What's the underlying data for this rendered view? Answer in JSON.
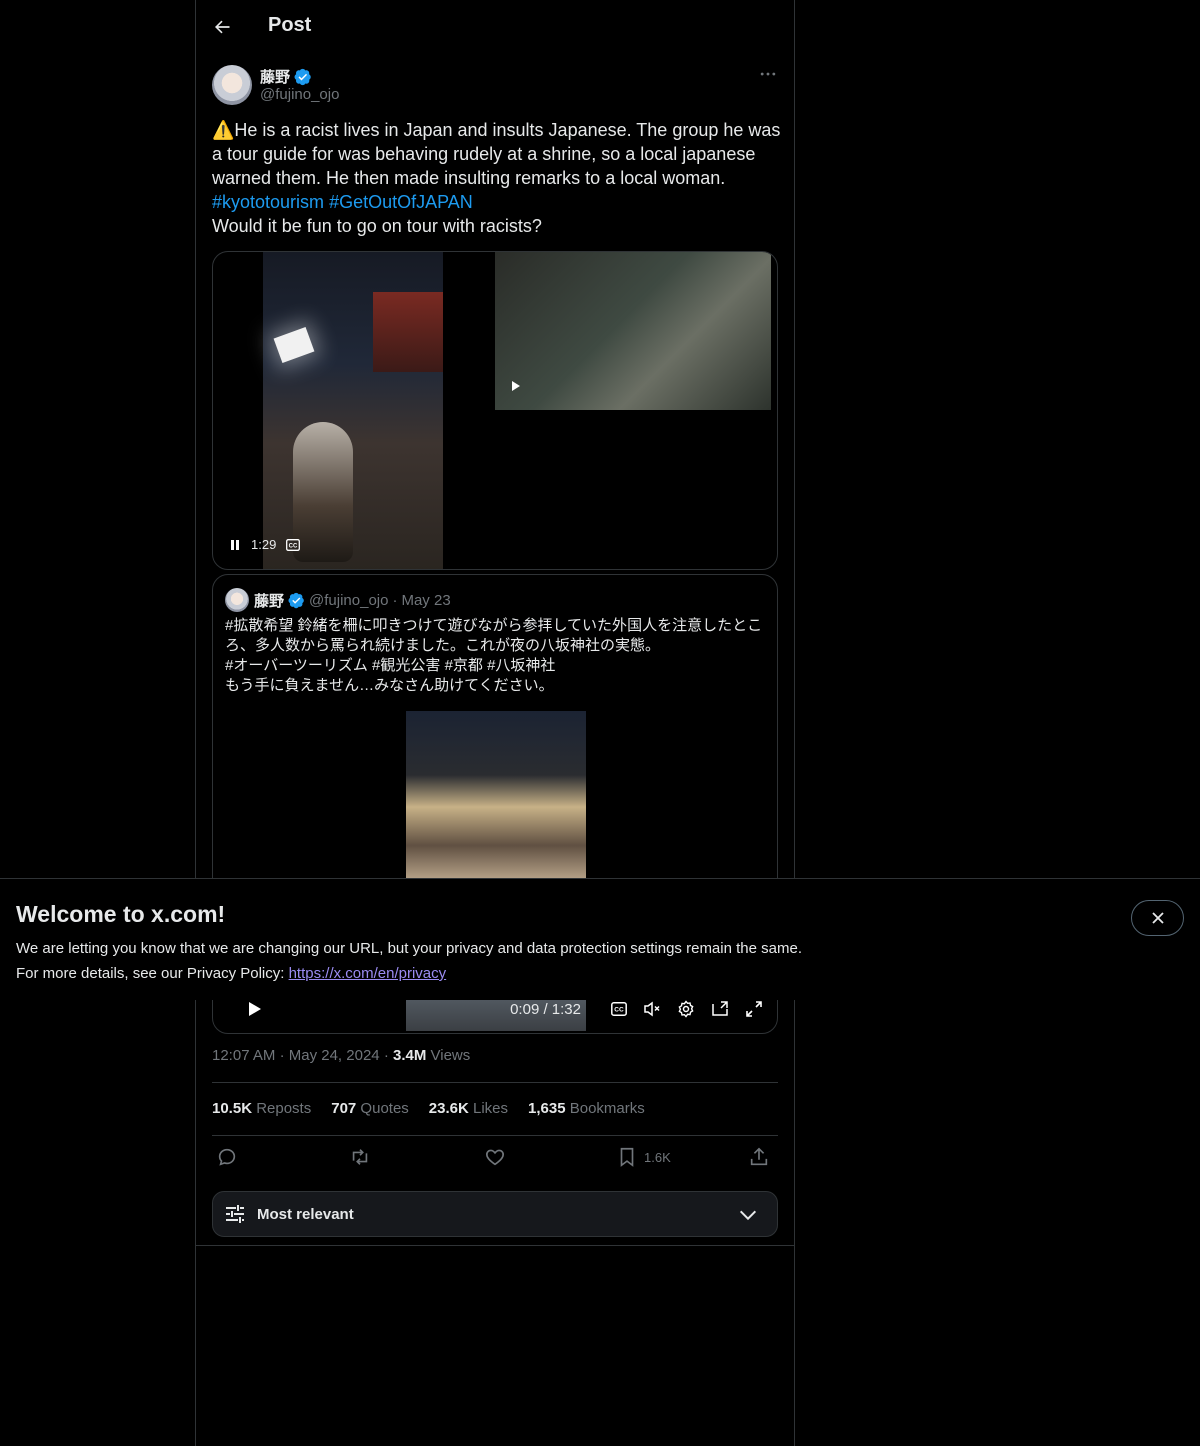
{
  "header": {
    "title": "Post"
  },
  "post": {
    "author_name": "藤野",
    "handle": "@fujino_ojo",
    "text_line1": "⚠️He is a racist lives in Japan and insults Japanese. The group he was a tour guide for was behaving rudely at a shrine, so a local japanese warned them. He then made insulting remarks to a local woman.",
    "hashtag1": "#kyototourism",
    "hashtag2": "#GetOutOfJAPAN",
    "text_line2": "Would it be fun to go on tour with racists?",
    "video_time": "1:29"
  },
  "quote": {
    "author_name": "藤野",
    "handle": "@fujino_ojo",
    "separator": "·",
    "date": "May 23",
    "text": "#拡散希望 鈴緒を柵に叩きつけて遊びながら参拝していた外国人を注意したところ、多人数から罵られ続けました。これが夜の八坂神社の実態。\n#オーバーツーリズム #観光公害 #京都 #八坂神社\nもう手に負えません…みなさん助けてください。",
    "video_time": "0:09 / 1:32"
  },
  "meta": {
    "time": "12:07 AM",
    "separator": "·",
    "date": "May 24, 2024",
    "separator2": "·",
    "views_value": "3.4M",
    "views_label": " Views"
  },
  "stats": {
    "reposts_value": "10.5K",
    "reposts_label": " Reposts",
    "quotes_value": "707",
    "quotes_label": " Quotes",
    "likes_value": "23.6K",
    "likes_label": " Likes",
    "bookmarks_value": "1,635",
    "bookmarks_label": " Bookmarks"
  },
  "actions": {
    "bookmark_count": "1.6K"
  },
  "sort": {
    "label": "Most relevant"
  },
  "banner": {
    "title": "Welcome to x.com!",
    "line1": "We are letting you know that we are changing our URL, but your privacy and data protection settings remain the same.",
    "line2_prefix": "For more details, see our Privacy Policy: ",
    "link": "https://x.com/en/privacy"
  },
  "colors": {
    "accent": "#1d9bf0",
    "muted": "#71767b",
    "border": "#2f3336",
    "link": "#9b8cf2"
  }
}
